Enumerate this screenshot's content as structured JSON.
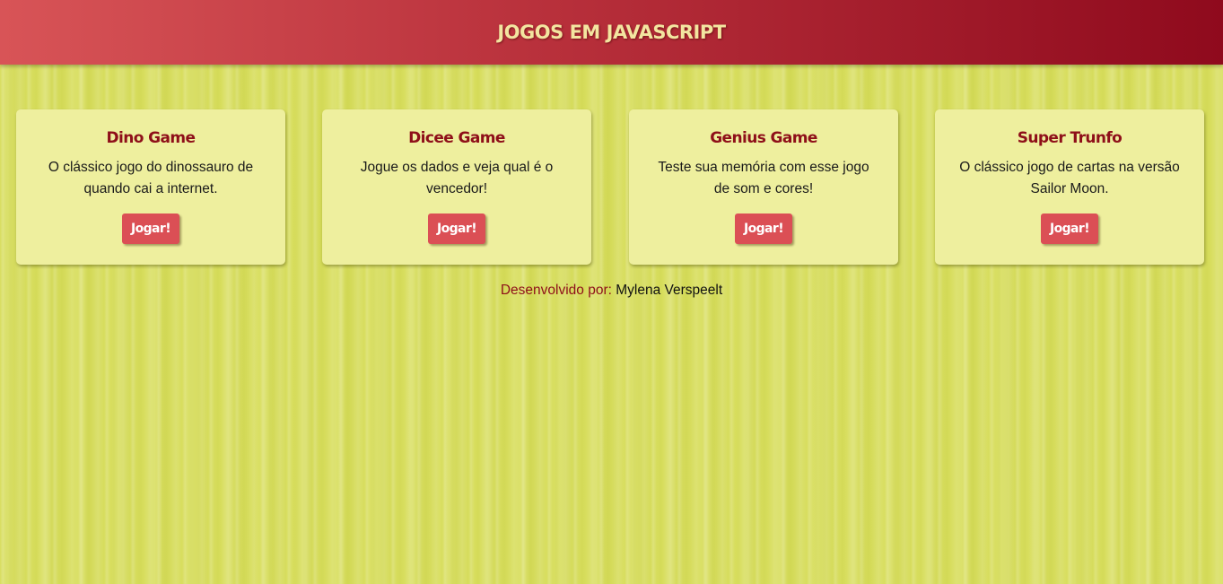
{
  "header": {
    "title": "JOGOS EM JAVASCRIPT"
  },
  "cards": [
    {
      "title": "Dino Game",
      "description": "O clássico jogo do dinossauro de quando cai a internet.",
      "button_label": "Jogar!"
    },
    {
      "title": "Dicee Game",
      "description": "Jogue os dados e veja qual é o vencedor!",
      "button_label": "Jogar!"
    },
    {
      "title": "Genius Game",
      "description": "Teste sua memória com esse jogo de som e cores!",
      "button_label": "Jogar!"
    },
    {
      "title": "Super Trunfo",
      "description": "O clássico jogo de cartas na versão Sailor Moon.",
      "button_label": "Jogar!"
    }
  ],
  "footer": {
    "label": "Desenvolvido por:",
    "author": "Mylena Verspeelt"
  },
  "colors": {
    "header_gradient_start": "#d85457",
    "header_gradient_end": "#8f0a1d",
    "header_text": "#f3e5a0",
    "background": "#d8de5e",
    "card_background": "#eeef9e",
    "card_title": "#8e0f19",
    "button_background": "#db4f55",
    "button_text": "#ffffff"
  }
}
